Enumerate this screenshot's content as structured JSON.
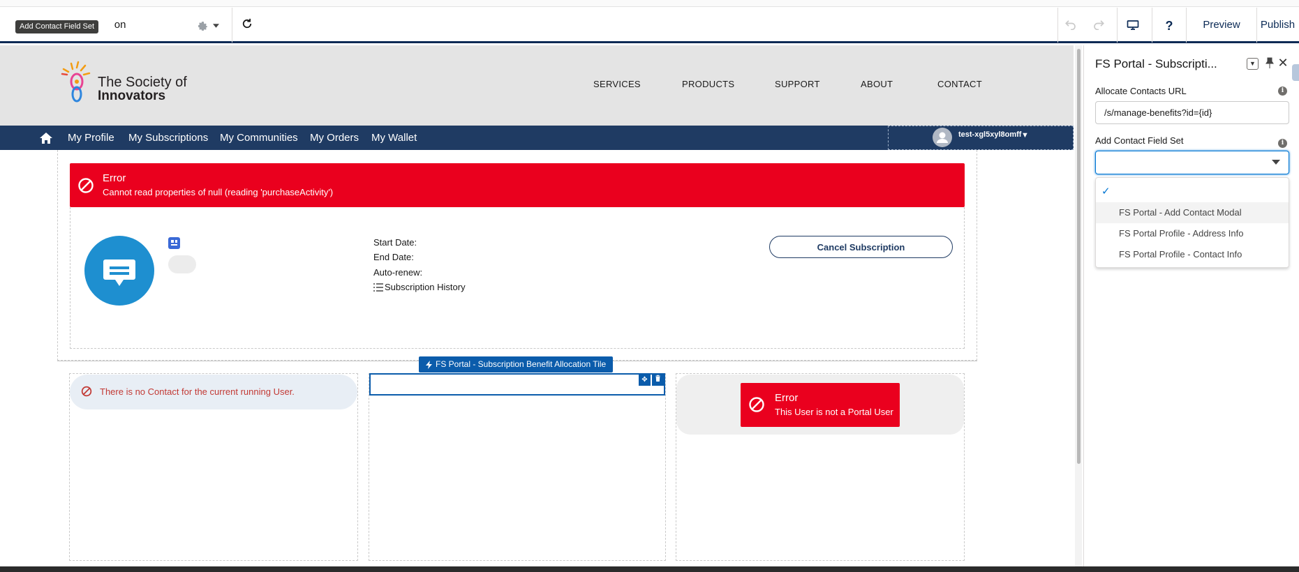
{
  "toolbar": {
    "page_name_suffix": "on",
    "tooltip": "Add Contact Field Set",
    "preview_label": "Preview",
    "publish_label": "Publish",
    "help_label": "?"
  },
  "site_header": {
    "logo_line1": "The Society of",
    "logo_line2": "Innovators",
    "nav": [
      "SERVICES",
      "PRODUCTS",
      "SUPPORT",
      "ABOUT",
      "CONTACT"
    ]
  },
  "navbar": {
    "links": [
      "My Profile",
      "My Subscriptions",
      "My Communities",
      "My Orders",
      "My Wallet"
    ],
    "user_name": "test-xgl5xyl8omff"
  },
  "subscription": {
    "error_title": "Error",
    "error_message": "Cannot read properties of null (reading 'purchaseActivity')",
    "start_date_label": "Start Date:",
    "end_date_label": "End Date:",
    "auto_renew_label": "Auto-renew:",
    "history_label": "Subscription History",
    "cancel_label": "Cancel Subscription"
  },
  "allocation": {
    "component_label": "FS Portal - Subscription Benefit Allocation Tile",
    "no_contact_message": "There is no Contact for the current running User.",
    "portal_error_title": "Error",
    "portal_error_message": "This User is not a Portal User"
  },
  "panel": {
    "title": "FS Portal - Subscripti...",
    "url_label": "Allocate Contacts URL",
    "url_value": "/s/manage-benefits?id={id}",
    "fieldset_label": "Add Contact Field Set",
    "fieldset_value": "",
    "options": [
      "FS Portal - Add Contact Modal",
      "FS Portal Profile - Address Info",
      "FS Portal Profile - Contact Info"
    ]
  },
  "colors": {
    "navbar": "#1f3b63",
    "error": "#ea001e",
    "accent": "#0b5cab",
    "avatar": "#1e8fd0"
  }
}
